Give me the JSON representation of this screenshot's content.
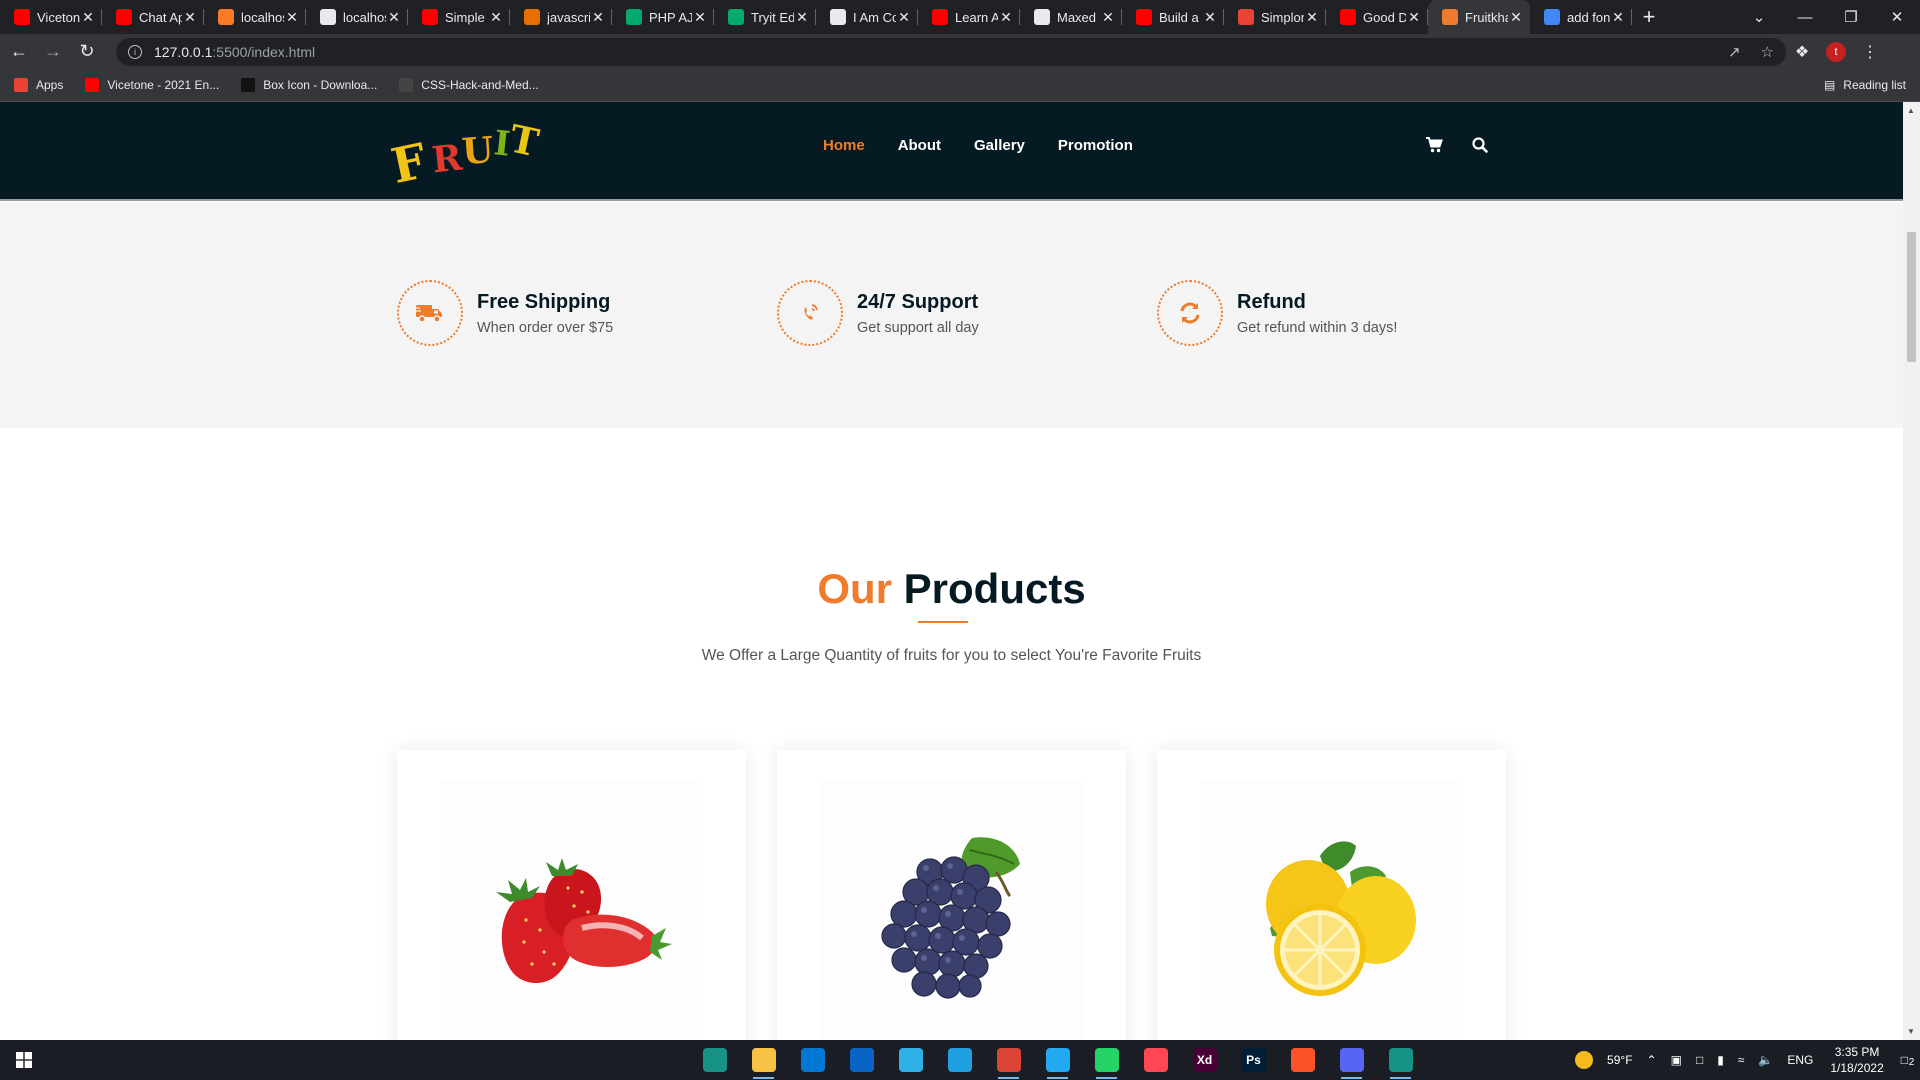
{
  "browser": {
    "tabs": [
      {
        "title": "Vicetone",
        "favicon": "youtube-icon",
        "color": "#ff0000"
      },
      {
        "title": "Chat App",
        "favicon": "youtube-icon",
        "color": "#ff0000"
      },
      {
        "title": "localhost",
        "favicon": "xampp-icon",
        "color": "#fb7a24"
      },
      {
        "title": "localhost",
        "favicon": "globe-icon",
        "color": "#e8eaed"
      },
      {
        "title": "Simple",
        "favicon": "youtube-icon",
        "color": "#ff0000"
      },
      {
        "title": "javascript",
        "favicon": "java-icon",
        "color": "#e76f00"
      },
      {
        "title": "PHP AJAX",
        "favicon": "w-icon",
        "color": "#04aa6d"
      },
      {
        "title": "Tryit Editor",
        "favicon": "w-icon",
        "color": "#04aa6d"
      },
      {
        "title": "I Am Coding",
        "favicon": "github-icon",
        "color": "#e8eaed"
      },
      {
        "title": "Learn API",
        "favicon": "youtube-icon",
        "color": "#ff0000"
      },
      {
        "title": "Maxed",
        "favicon": "github-icon",
        "color": "#e8eaed"
      },
      {
        "title": "Build a",
        "favicon": "youtube-icon",
        "color": "#ff0000"
      },
      {
        "title": "Simplon",
        "favicon": "alert-icon",
        "color": "#ea4335"
      },
      {
        "title": "Good D",
        "favicon": "youtube-icon",
        "color": "#ff0000"
      },
      {
        "title": "Fruitkha",
        "favicon": "basket-icon",
        "color": "#ef7c2d",
        "active": true
      },
      {
        "title": "add fon",
        "favicon": "google-icon",
        "color": "#4285f4"
      }
    ],
    "url_host": "127.0.0.1",
    "url_rest": ":5500/index.html",
    "profile_initial": "t",
    "bookmarks": [
      {
        "label": "Apps",
        "icon": "apps-grid-icon",
        "color": "#ea4335"
      },
      {
        "label": "Vicetone - 2021 En...",
        "icon": "youtube-icon",
        "color": "#ff0000"
      },
      {
        "label": "Box Icon - Downloa...",
        "icon": "boxicons-icon",
        "color": "#111111"
      },
      {
        "label": "CSS-Hack-and-Med...",
        "icon": "github-icon",
        "color": "#444444"
      }
    ],
    "reading_list": "Reading list"
  },
  "site": {
    "logo_letters": [
      "F",
      "R",
      "U",
      "I",
      "T"
    ],
    "nav": [
      {
        "label": "Home",
        "active": true
      },
      {
        "label": "About",
        "active": false
      },
      {
        "label": "Gallery",
        "active": false
      },
      {
        "label": "Promotion",
        "active": false
      }
    ],
    "header_icons": [
      "cart-icon",
      "search-icon"
    ],
    "accent_color": "#ef7c2d",
    "dark_color": "#051922",
    "features": [
      {
        "icon": "truck-icon",
        "title": "Free Shipping",
        "text": "When order over $75"
      },
      {
        "icon": "phone-icon",
        "title": "24/7 Support",
        "text": "Get support all day"
      },
      {
        "icon": "refresh-icon",
        "title": "Refund",
        "text": "Get refund within 3 days!"
      }
    ],
    "products_title_accent": "Our",
    "products_title": "Products",
    "products_subtitle": "We Offer a Large Quantity of fruits for you to select You're Favorite Fruits",
    "products": [
      {
        "name": "strawberry"
      },
      {
        "name": "grapes"
      },
      {
        "name": "lemon"
      }
    ]
  },
  "taskbar": {
    "apps": [
      {
        "name": "gitkraken-icon",
        "color": "#179287",
        "running": false
      },
      {
        "name": "file-explorer-icon",
        "color": "#f6c244",
        "running": true
      },
      {
        "name": "store-icon",
        "color": "#0078d4",
        "running": false
      },
      {
        "name": "mail-icon",
        "color": "#0a64c8",
        "running": false
      },
      {
        "name": "edge-icon",
        "color": "#2fb0e6",
        "running": false
      },
      {
        "name": "ccleaner-icon",
        "color": "#1fa0e0",
        "running": false
      },
      {
        "name": "chrome-icon",
        "color": "#db4437",
        "running": true
      },
      {
        "name": "vscode-icon",
        "color": "#23a9f2",
        "running": true
      },
      {
        "name": "whatsapp-icon",
        "color": "#25d366",
        "running": true
      },
      {
        "name": "valorant-icon",
        "color": "#ff4655",
        "running": false
      },
      {
        "name": "adobe-xd-icon",
        "color": "#470137",
        "running": false
      },
      {
        "name": "photoshop-icon",
        "color": "#001e36",
        "running": false
      },
      {
        "name": "brave-icon",
        "color": "#fb542b",
        "running": false
      },
      {
        "name": "discord-icon",
        "color": "#5865f2",
        "running": true
      },
      {
        "name": "gitkraken-icon",
        "color": "#179287",
        "running": true
      }
    ],
    "app_labels": {
      "xd": "Xd",
      "ps": "Ps"
    },
    "weather": "59°F",
    "language": "ENG",
    "time": "3:35 PM",
    "date": "1/18/2022",
    "notification_count": "2"
  }
}
